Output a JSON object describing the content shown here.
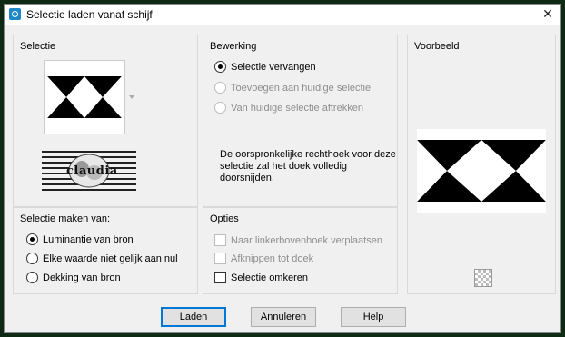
{
  "window": {
    "title": "Selectie laden vanaf schijf",
    "close_glyph": "✕"
  },
  "selectie": {
    "title": "Selectie",
    "watermark_text": "claudia"
  },
  "bewerking": {
    "title": "Bewerking",
    "options": [
      {
        "label": "Selectie vervangen",
        "checked": true,
        "enabled": true
      },
      {
        "label": "Toevoegen aan huidige selectie",
        "checked": false,
        "enabled": false
      },
      {
        "label": "Van huidige selectie aftrekken",
        "checked": false,
        "enabled": false
      }
    ],
    "info": "De oorspronkelijke rechthoek voor deze selectie zal het doek volledig doorsnijden."
  },
  "voorbeeld": {
    "title": "Voorbeeld"
  },
  "maken_van": {
    "title": "Selectie maken van:",
    "options": [
      {
        "label": "Luminantie van bron",
        "checked": true
      },
      {
        "label": "Elke waarde niet gelijk aan nul",
        "checked": false
      },
      {
        "label": "Dekking van bron",
        "checked": false
      }
    ]
  },
  "opties": {
    "title": "Opties",
    "checks": [
      {
        "label": "Naar linkerbovenhoek verplaatsen",
        "checked": false,
        "enabled": false
      },
      {
        "label": "Afknippen tot doek",
        "checked": false,
        "enabled": false
      },
      {
        "label": "Selectie omkeren",
        "checked": false,
        "enabled": true
      }
    ]
  },
  "buttons": {
    "ok": "Laden",
    "cancel": "Annuleren",
    "help": "Help"
  }
}
